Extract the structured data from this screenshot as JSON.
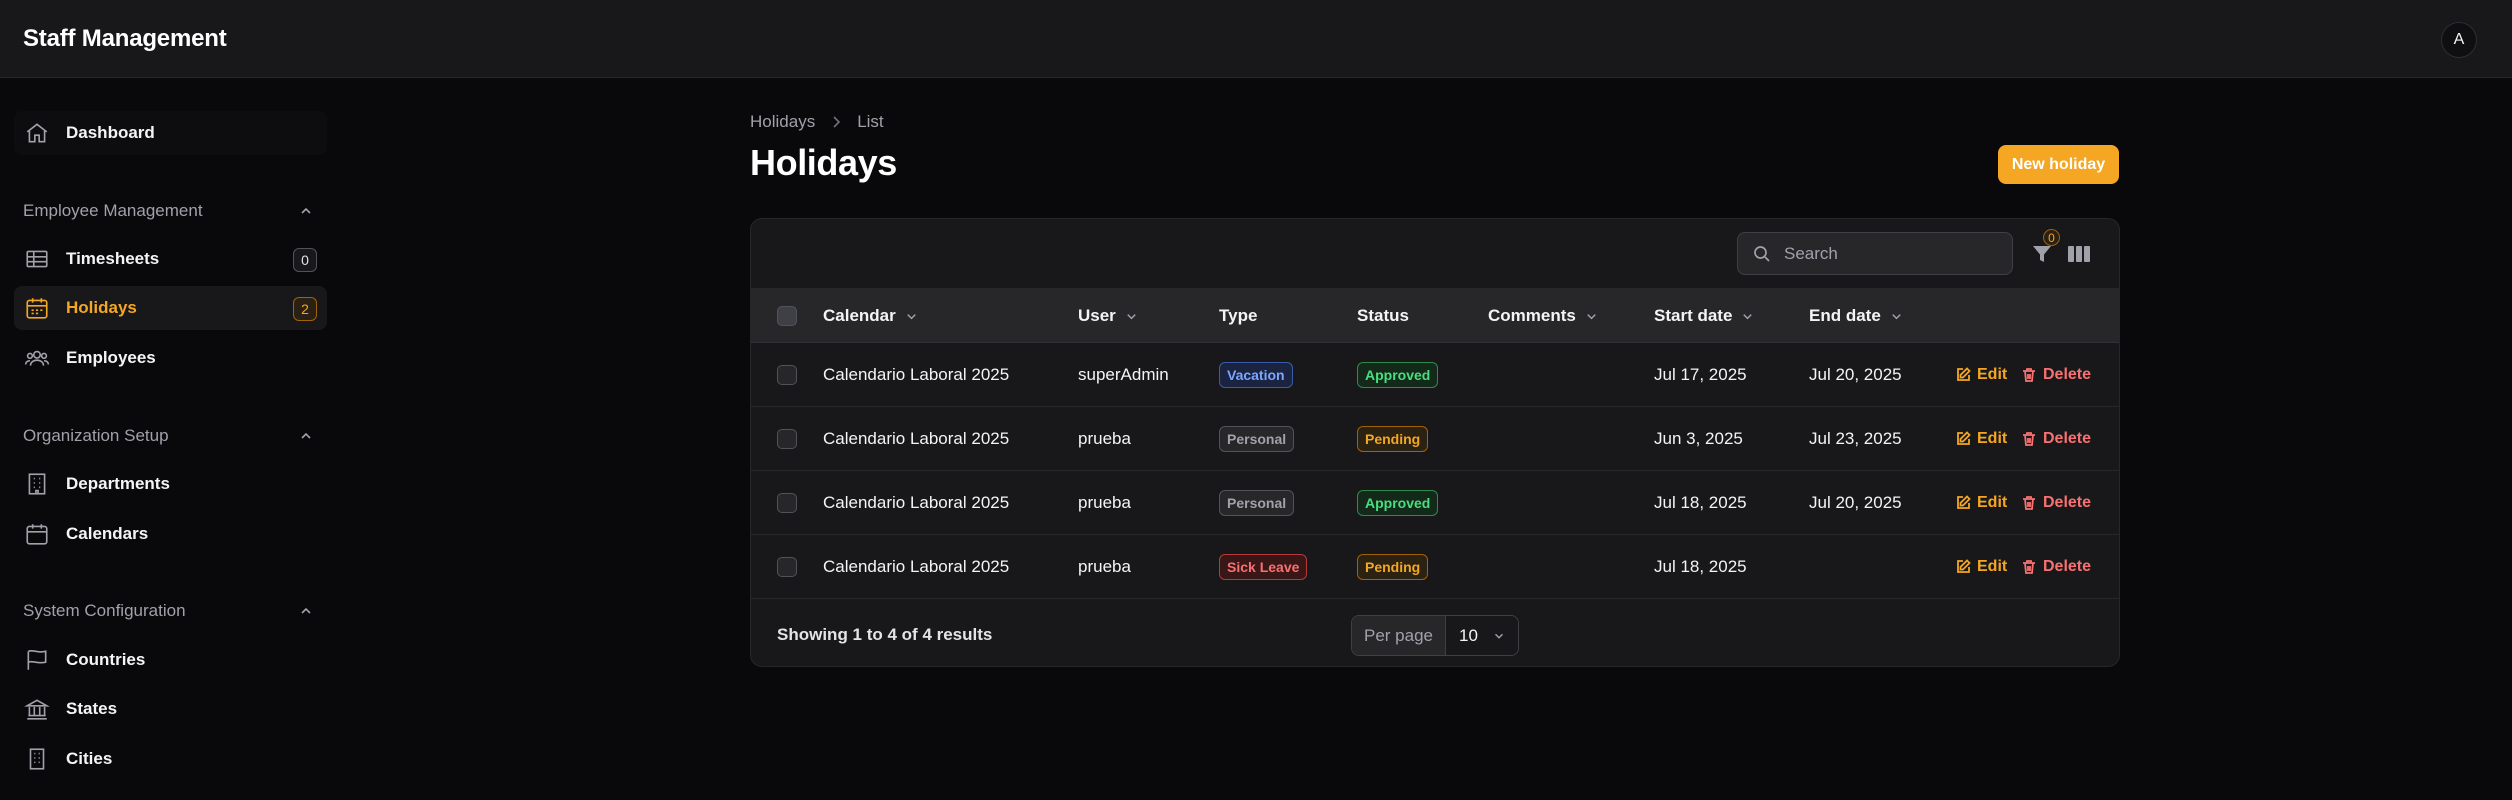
{
  "app": {
    "title": "Staff Management",
    "avatar_initial": "A"
  },
  "sidebar": {
    "dashboard": {
      "label": "Dashboard",
      "icon": "home-icon"
    },
    "groups": [
      {
        "label": "Employee Management",
        "items": [
          {
            "label": "Timesheets",
            "icon": "table-icon",
            "badge": "0"
          },
          {
            "label": "Holidays",
            "icon": "calendar-days-icon",
            "badge": "2",
            "active": true
          },
          {
            "label": "Employees",
            "icon": "users-icon"
          }
        ]
      },
      {
        "label": "Organization Setup",
        "items": [
          {
            "label": "Departments",
            "icon": "building-icon"
          },
          {
            "label": "Calendars",
            "icon": "calendar-icon"
          }
        ]
      },
      {
        "label": "System Configuration",
        "items": [
          {
            "label": "Countries",
            "icon": "flag-icon"
          },
          {
            "label": "States",
            "icon": "library-icon"
          },
          {
            "label": "Cities",
            "icon": "office-building-icon"
          }
        ]
      }
    ]
  },
  "breadcrumb": {
    "parent": "Holidays",
    "current": "List"
  },
  "page": {
    "title": "Holidays",
    "new_button": "New holiday"
  },
  "toolbar": {
    "search_placeholder": "Search",
    "filter_count": "0"
  },
  "table": {
    "columns": {
      "calendar": "Calendar",
      "user": "User",
      "type": "Type",
      "status": "Status",
      "comments": "Comments",
      "start_date": "Start date",
      "end_date": "End date"
    },
    "rows": [
      {
        "calendar": "Calendario Laboral 2025",
        "user": "superAdmin",
        "type": "Vacation",
        "status": "Approved",
        "comments": "",
        "start_date": "Jul 17, 2025",
        "end_date": "Jul 20, 2025",
        "edit": "Edit",
        "delete": "Delete"
      },
      {
        "calendar": "Calendario Laboral 2025",
        "user": "prueba",
        "type": "Personal",
        "status": "Pending",
        "comments": "",
        "start_date": "Jun 3, 2025",
        "end_date": "Jul 23, 2025",
        "edit": "Edit",
        "delete": "Delete"
      },
      {
        "calendar": "Calendario Laboral 2025",
        "user": "prueba",
        "type": "Personal",
        "status": "Approved",
        "comments": "",
        "start_date": "Jul 18, 2025",
        "end_date": "Jul 20, 2025",
        "edit": "Edit",
        "delete": "Delete"
      },
      {
        "calendar": "Calendario Laboral 2025",
        "user": "prueba",
        "type": "Sick Leave",
        "status": "Pending",
        "comments": "",
        "start_date": "Jul 18, 2025",
        "end_date": "",
        "edit": "Edit",
        "delete": "Delete"
      }
    ],
    "footer": {
      "showing": "Showing 1 to 4 of 4 results",
      "per_page_label": "Per page",
      "per_page_value": "10"
    }
  },
  "colors": {
    "accent": "#f5a623",
    "danger": "#f87171",
    "success": "#4ade80",
    "info": "#7ea6ff"
  }
}
